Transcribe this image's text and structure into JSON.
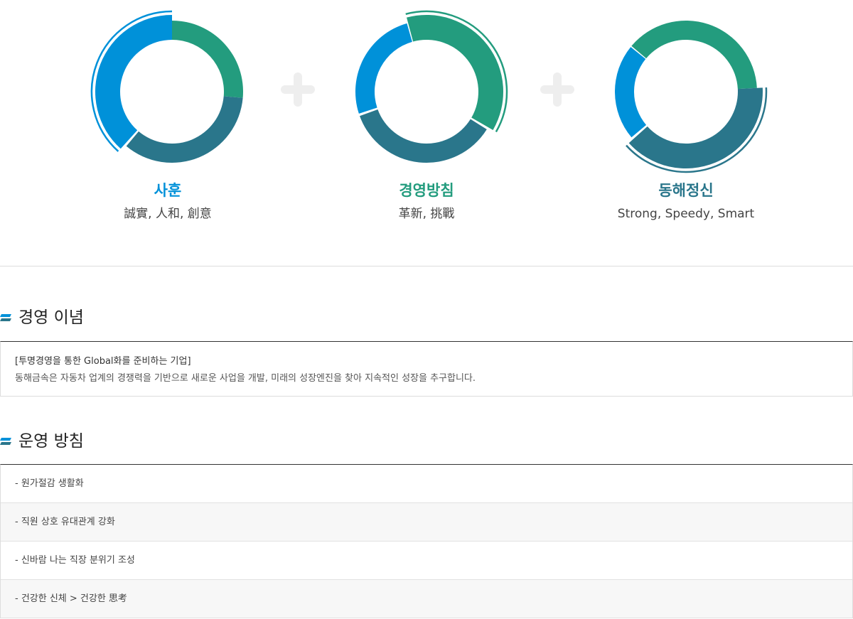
{
  "colors": {
    "blue": "#0091d9",
    "green": "#239c7e",
    "teal": "#2a768b",
    "plus": "#eeeeee",
    "rule": "#333333"
  },
  "values": [
    {
      "title": "사훈",
      "subtitle": "誠實, 人和, 創意",
      "title_color": "#0091d9"
    },
    {
      "title": "경영방침",
      "subtitle": "革新, 挑戰",
      "title_color": "#239c7e"
    },
    {
      "title": "동해정신",
      "subtitle": "Strong, Speedy, Smart",
      "title_color": "#2a768b"
    }
  ],
  "philosophy": {
    "title": "경영 이념",
    "line1": "[투명경영을 통한 Global화를 준비하는 기업]",
    "line2": "동해금속은 자동차 업계의 경쟁력을 기반으로 새로운 사업을 개발, 미래의 성장엔진을 찾아 지속적인 성장을 추구합니다."
  },
  "policy": {
    "title": "운영 방침",
    "items": [
      "- 원가절감 생활화",
      "- 직원 상호 유대관계 강화",
      "- 신바람 나는 직장 분위기 조성",
      "- 건강한 신체 > 건강한 思考"
    ]
  }
}
